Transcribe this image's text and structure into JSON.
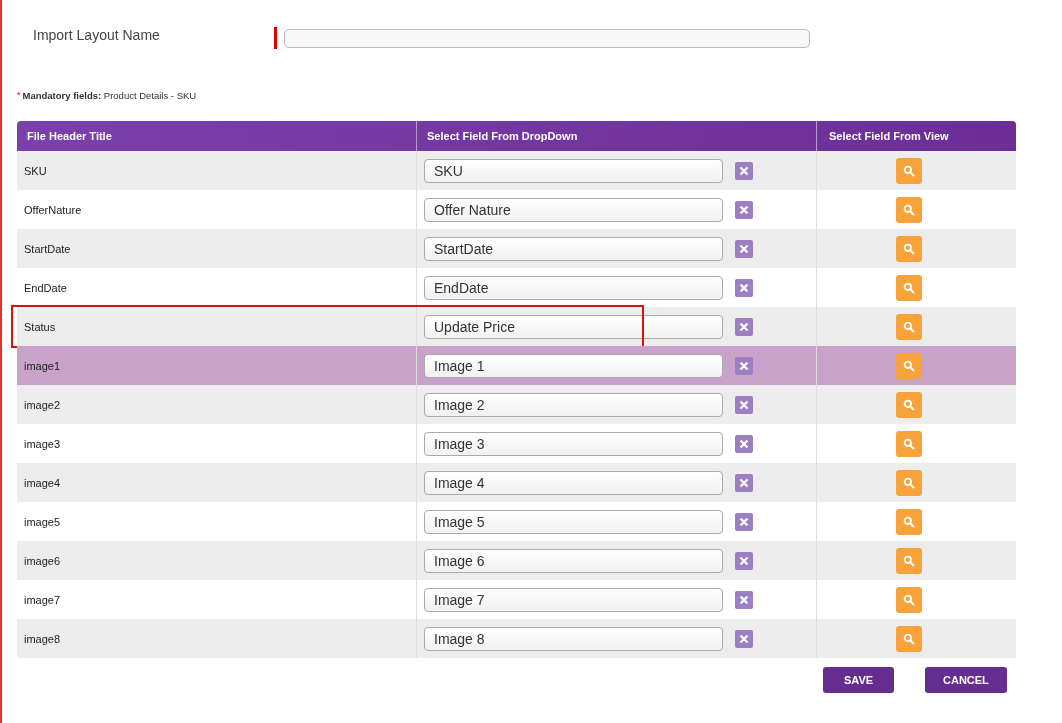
{
  "layout_name": {
    "label": "Import Layout Name"
  },
  "mandatory_mark": "*",
  "mandatory_note": "**Mandatory fields:** Product Details - SKU",
  "table": {
    "columns": [
      "File Header Title",
      "Select Field From DropDown",
      "Select Field From View"
    ],
    "rows": [
      {
        "header": "SKU",
        "field": "SKU",
        "selected": false,
        "annotated": false
      },
      {
        "header": "OfferNature",
        "field": "Offer Nature",
        "selected": false,
        "annotated": false
      },
      {
        "header": "StartDate",
        "field": "StartDate",
        "selected": false,
        "annotated": false
      },
      {
        "header": "EndDate",
        "field": "EndDate",
        "selected": false,
        "annotated": false
      },
      {
        "header": "Status",
        "field": "Update Price",
        "selected": false,
        "annotated": true
      },
      {
        "header": "image1",
        "field": "Image 1",
        "selected": true,
        "annotated": false
      },
      {
        "header": "image2",
        "field": "Image 2",
        "selected": false,
        "annotated": false
      },
      {
        "header": "image3",
        "field": "Image 3",
        "selected": false,
        "annotated": false
      },
      {
        "header": "image4",
        "field": "Image 4",
        "selected": false,
        "annotated": false
      },
      {
        "header": "image5",
        "field": "Image 5",
        "selected": false,
        "annotated": false
      },
      {
        "header": "image6",
        "field": "Image 6",
        "selected": false,
        "annotated": false
      },
      {
        "header": "image7",
        "field": "Image 7",
        "selected": false,
        "annotated": false
      },
      {
        "header": "image8",
        "field": "Image 8",
        "selected": false,
        "annotated": false
      }
    ]
  },
  "buttons": [
    "SAVE",
    "CANCEL"
  ]
}
